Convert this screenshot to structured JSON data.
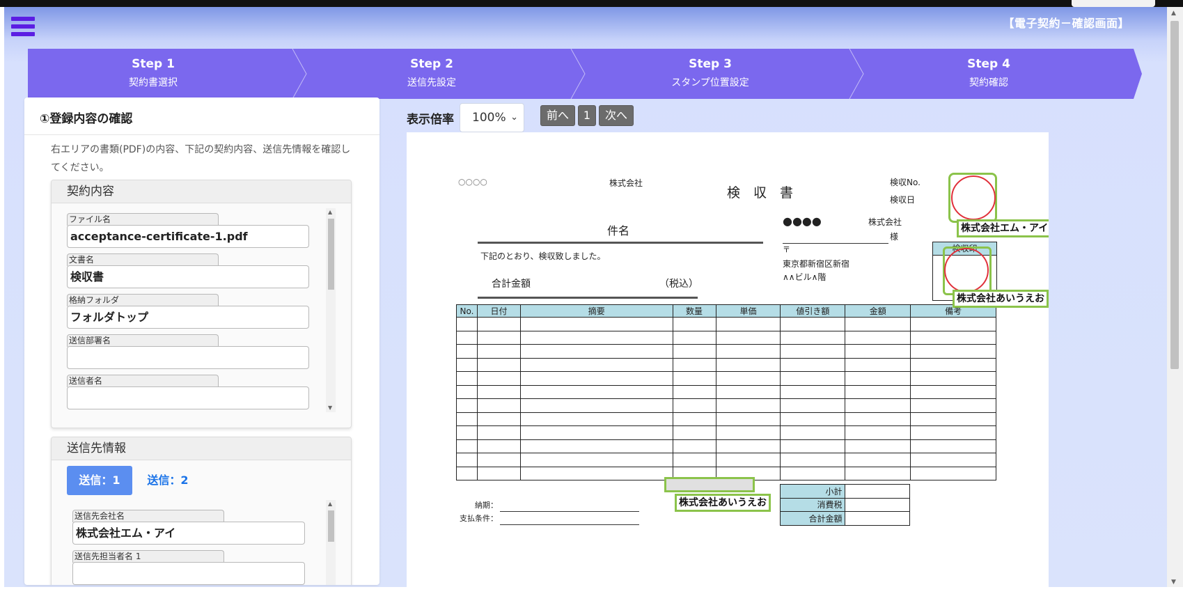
{
  "header": {
    "title": "【電子契約－確認画面】",
    "menu_icon": "hamburger-menu-icon"
  },
  "steps": [
    {
      "step": "Step 1",
      "label": "契約書選択"
    },
    {
      "step": "Step 2",
      "label": "送信先設定"
    },
    {
      "step": "Step 3",
      "label": "スタンプ位置設定"
    },
    {
      "step": "Step 4",
      "label": "契約確認"
    }
  ],
  "colors": {
    "step_bar": "#7b68ee",
    "accent": "#5b1ee3",
    "highlight": "#8bc34a",
    "stamp": "#e0303a",
    "tab_active": "#5b8ef0"
  },
  "left_panel": {
    "title": "①登録内容の確認",
    "description": "右エリアの書類(PDF)の内容、下記の契約内容、送信先情報を確認してください。",
    "contract": {
      "heading": "契約内容",
      "fields": [
        {
          "label": "ファイル名",
          "value": "acceptance-certificate-1.pdf"
        },
        {
          "label": "文書名",
          "value": "検収書"
        },
        {
          "label": "格納フォルダ",
          "value": "フォルダトップ"
        },
        {
          "label": "送信部署名",
          "value": ""
        },
        {
          "label": "送信者名",
          "value": ""
        }
      ]
    },
    "recipients": {
      "heading": "送信先情報",
      "tabs": [
        "送信：1",
        "送信：2"
      ],
      "active_tab": 0,
      "fields": [
        {
          "label": "送信先会社名",
          "value": "株式会社エム・アイ"
        },
        {
          "label": "送信先担当者名 1",
          "value": ""
        }
      ]
    }
  },
  "viewer": {
    "zoom_label": "表示倍率",
    "zoom_value": "100%",
    "prev": "前へ",
    "page": "1",
    "next": "次へ"
  },
  "document": {
    "dots_left": "○○○○",
    "company_label_left": "株式会社",
    "title": "検　収　書",
    "no_label": "検収No.",
    "date_label": "検収日",
    "subject_label": "件名",
    "dots_right": "●●●●",
    "company_label_right": "株式会社",
    "sama": "様",
    "postal_mark": "〒",
    "address_1": "東京都新宿区新宿",
    "address_2": "∧∧ビル∧階",
    "body_text": "下記のとおり、検収致しました。",
    "total_label": "合計金額",
    "tax_included": "（税込）",
    "stamp_header": "検収印",
    "table_headers": [
      "No.",
      "日付",
      "摘要",
      "数量",
      "単価",
      "値引き額",
      "金額",
      "備考"
    ],
    "row_count": 12,
    "totals": [
      "小計",
      "消費税",
      "合計金額"
    ],
    "due_label": "納期：",
    "payment_label": "支払条件：",
    "stamps": {
      "recipient": "株式会社エム・アイ",
      "sender_top": "株式会社あいうえお",
      "sender_bottom": "株式会社あいうえお"
    }
  }
}
